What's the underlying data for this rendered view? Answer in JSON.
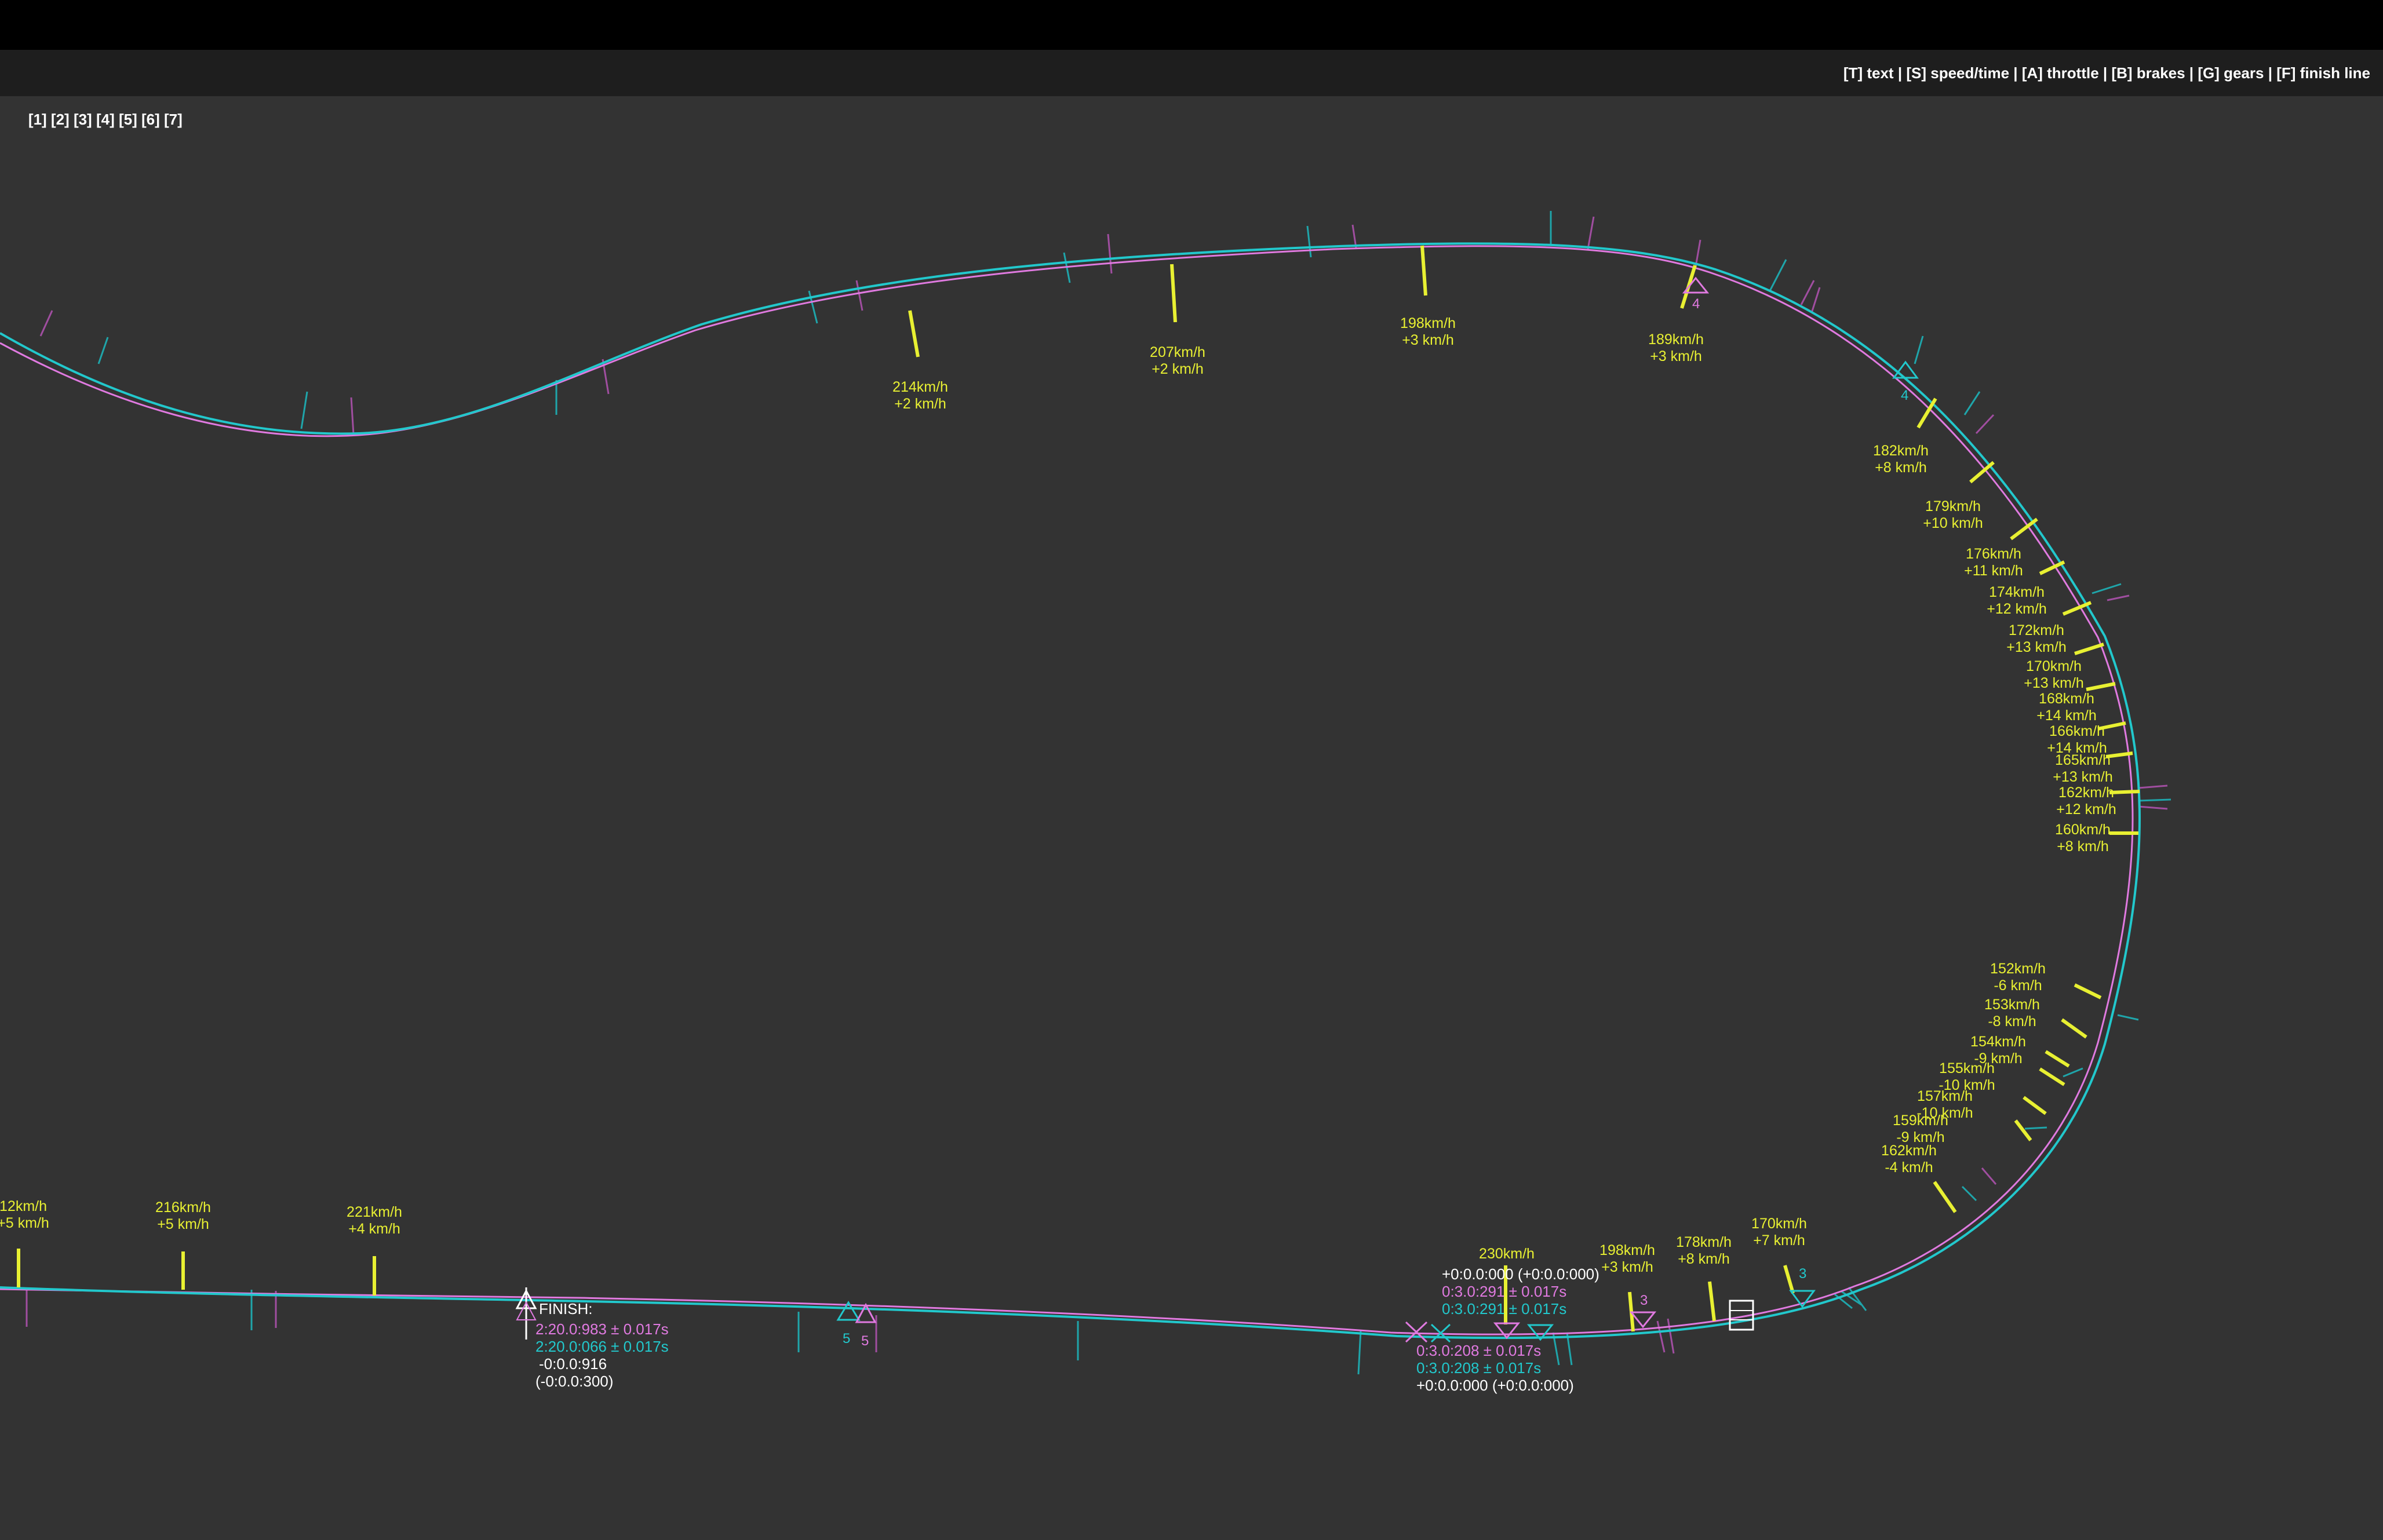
{
  "toolbar": {
    "layout_keys": [
      "[1]",
      "[2]",
      "[3]",
      "[4]",
      "[5]",
      "[6]",
      "[7]"
    ],
    "toggles": [
      {
        "key": "[T]",
        "label": "text"
      },
      {
        "key": "[S]",
        "label": "speed/time"
      },
      {
        "key": "[A]",
        "label": "throttle"
      },
      {
        "key": "[B]",
        "label": "brakes"
      },
      {
        "key": "[G]",
        "label": "gears"
      },
      {
        "key": "[F]",
        "label": "finish line"
      }
    ],
    "separator": " | "
  },
  "colors": {
    "background": "#333333",
    "lap_a": "#e07ae0",
    "lap_b": "#22c8cc",
    "speed_marker": "#e8f032",
    "speed_text": "#e8f032",
    "label_white": "#ffffff"
  },
  "speed_labels": [
    {
      "speed": "12km/h",
      "delta": "+5 km/h"
    },
    {
      "speed": "216km/h",
      "delta": "+5 km/h"
    },
    {
      "speed": "221km/h",
      "delta": "+4 km/h"
    },
    {
      "speed": "214km/h",
      "delta": "+2 km/h"
    },
    {
      "speed": "207km/h",
      "delta": "+2 km/h"
    },
    {
      "speed": "198km/h",
      "delta": "+3 km/h"
    },
    {
      "speed": "189km/h",
      "delta": "+3 km/h"
    },
    {
      "speed": "182km/h",
      "delta": "+8 km/h"
    },
    {
      "speed": "179km/h",
      "delta": "+10 km/h"
    },
    {
      "speed": "176km/h",
      "delta": "+11 km/h"
    },
    {
      "speed": "174km/h",
      "delta": "+12 km/h"
    },
    {
      "speed": "172km/h",
      "delta": "+13 km/h"
    },
    {
      "speed": "170km/h",
      "delta": "+13 km/h"
    },
    {
      "speed": "168km/h",
      "delta": "+14 km/h"
    },
    {
      "speed": "166km/h",
      "delta": "+14 km/h"
    },
    {
      "speed": "165km/h",
      "delta": "+13 km/h"
    },
    {
      "speed": "162km/h",
      "delta": "+12 km/h"
    },
    {
      "speed": "160km/h",
      "delta": "+8 km/h"
    },
    {
      "speed": "152km/h",
      "delta": "-6 km/h"
    },
    {
      "speed": "153km/h",
      "delta": "-8 km/h"
    },
    {
      "speed": "154km/h",
      "delta": "-9 km/h"
    },
    {
      "speed": "155km/h",
      "delta": "-10 km/h"
    },
    {
      "speed": "157km/h",
      "delta": "-10 km/h"
    },
    {
      "speed": "159km/h",
      "delta": "-9 km/h"
    },
    {
      "speed": "162km/h",
      "delta": "-4 km/h"
    },
    {
      "speed": "230km/h",
      "delta": ""
    },
    {
      "speed": "198km/h",
      "delta": "+3 km/h"
    },
    {
      "speed": "178km/h",
      "delta": "+8 km/h"
    },
    {
      "speed": "170km/h",
      "delta": "+7 km/h"
    }
  ],
  "gear_labels": [
    "4",
    "4",
    "3",
    "3",
    "5",
    "5"
  ],
  "finish": {
    "title": "FINISH:",
    "lap_a_time": "2:20.0:983 ± 0.017s",
    "lap_b_time": "2:20.0:066 ± 0.017s",
    "delta": "-0:0.0:916",
    "delta_paren": "(-0:0.0:300)"
  },
  "split_upper": {
    "delta": "+0:0.0:000 (+0:0.0:000)",
    "lap_a_time": "0:3.0:291 ± 0.017s",
    "lap_b_time": "0:3.0:291 ± 0.017s"
  },
  "split_lower": {
    "lap_a_time": "0:3.0:208 ± 0.017s",
    "lap_b_time": "0:3.0:208 ± 0.017s",
    "delta": "+0:0.0:000 (+0:0.0:000)"
  }
}
